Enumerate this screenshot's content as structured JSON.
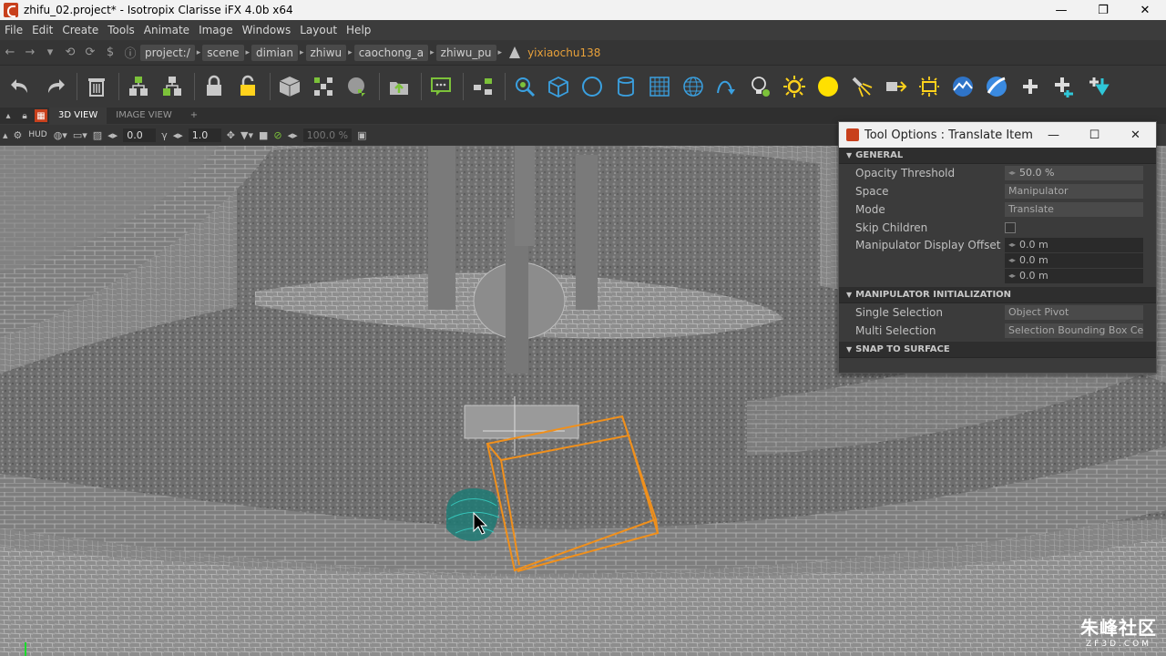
{
  "window": {
    "title": "zhifu_02.project* - Isotropix Clarisse iFX 4.0b x64",
    "minimize": "—",
    "restore": "❐",
    "close": "✕"
  },
  "menu": [
    "File",
    "Edit",
    "Create",
    "Tools",
    "Animate",
    "Image",
    "Windows",
    "Layout",
    "Help"
  ],
  "path": {
    "crumbs": [
      "project:/",
      "scene",
      "dimian",
      "zhiwu",
      "caochong_a",
      "zhiwu_pu"
    ],
    "current": "yixiaochu138"
  },
  "tabs": {
    "view3d": "3D VIEW",
    "image_view": "IMAGE VIEW",
    "add": "+"
  },
  "viewport_toolbar": {
    "hud": "HUD",
    "field1": "0.0",
    "field2": "1.0",
    "field3": "100.0 %"
  },
  "tool_options": {
    "title": "Tool Options : Translate Item",
    "sections": {
      "general": "GENERAL",
      "manip_init": "MANIPULATOR INITIALIZATION",
      "snap": "SNAP TO SURFACE"
    },
    "general": {
      "opacity_label": "Opacity Threshold",
      "opacity_value": "50.0 %",
      "opacity_fraction": 0.5,
      "space_label": "Space",
      "space_value": "Manipulator",
      "mode_label": "Mode",
      "mode_value": "Translate",
      "skip_label": "Skip Children",
      "offset_label": "Manipulator Display Offset",
      "offset_x": "0.0 m",
      "offset_y": "0.0 m",
      "offset_z": "0.0 m"
    },
    "manip_init": {
      "single_label": "Single Selection",
      "single_value": "Object Pivot",
      "multi_label": "Multi Selection",
      "multi_value": "Selection Bounding Box Cer"
    }
  },
  "watermark": {
    "cn": "朱峰社区",
    "en": "ZF3D.COM"
  },
  "colors": {
    "accent_orange": "#e8a13a",
    "selection_box": "#f0901c",
    "wire_teal": "#1aa7a0"
  }
}
